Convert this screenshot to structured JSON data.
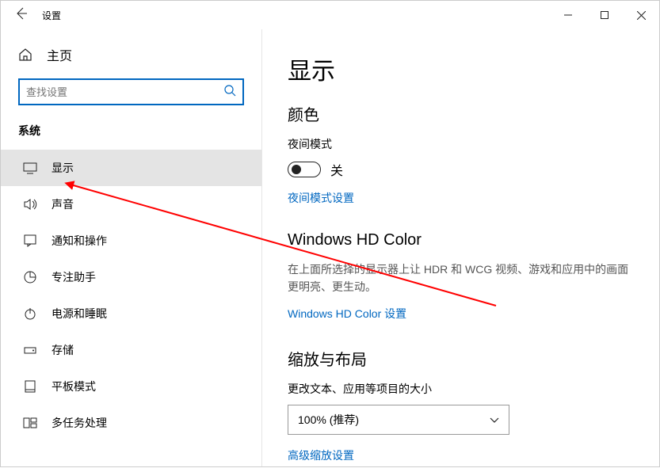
{
  "titlebar": {
    "app_name": "设置"
  },
  "sidebar": {
    "home_label": "主页",
    "search_placeholder": "查找设置",
    "section_label": "系统",
    "items": [
      {
        "label": "显示"
      },
      {
        "label": "声音"
      },
      {
        "label": "通知和操作"
      },
      {
        "label": "专注助手"
      },
      {
        "label": "电源和睡眠"
      },
      {
        "label": "存储"
      },
      {
        "label": "平板模式"
      },
      {
        "label": "多任务处理"
      }
    ]
  },
  "content": {
    "page_title": "显示",
    "color": {
      "title": "颜色",
      "night_label": "夜间模式",
      "toggle_state": "关",
      "settings_link": "夜间模式设置"
    },
    "hd": {
      "title": "Windows HD Color",
      "desc": "在上面所选择的显示器上让 HDR 和 WCG 视频、游戏和应用中的画面更明亮、更生动。",
      "settings_link": "Windows HD Color 设置"
    },
    "scale": {
      "title": "缩放与布局",
      "sub_label": "更改文本、应用等项目的大小",
      "dropdown_value": "100% (推荐)",
      "advanced_link": "高级缩放设置"
    }
  }
}
